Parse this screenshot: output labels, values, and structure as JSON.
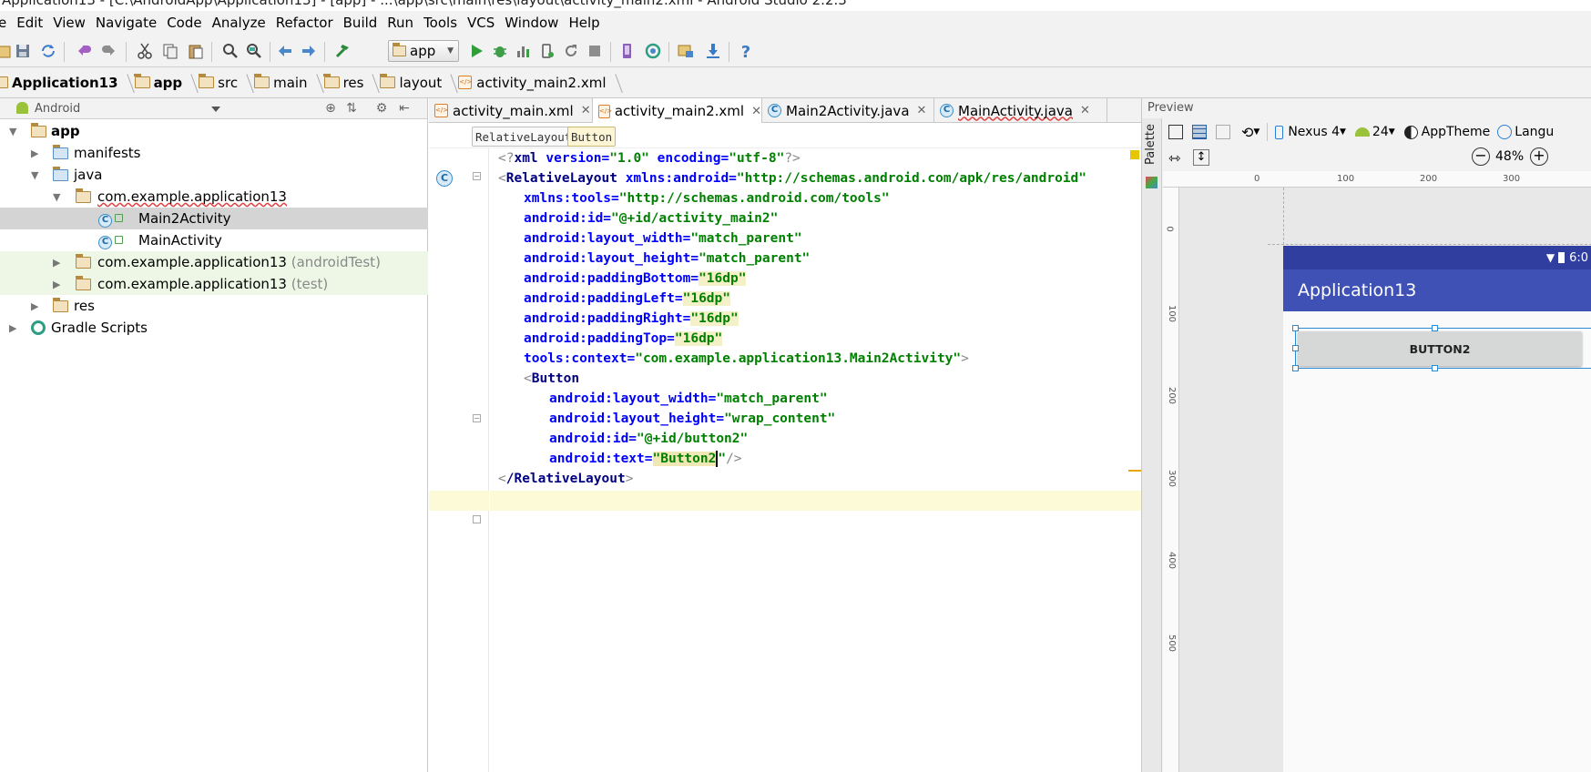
{
  "window": {
    "title": "Application13 - [C:\\AndroidApp\\Application13] - [app] - ...\\app\\src\\main\\res\\layout\\activity_main2.xml - Android Studio 2.2.3"
  },
  "menu": [
    "e",
    "Edit",
    "View",
    "Navigate",
    "Code",
    "Analyze",
    "Refactor",
    "Build",
    "Run",
    "Tools",
    "VCS",
    "Window",
    "Help"
  ],
  "toolbar": {
    "run_config": "app",
    "icons": [
      "save-icon",
      "sync-icon",
      "undo-icon",
      "redo-icon",
      "cut-icon",
      "copy-icon",
      "paste-icon",
      "find-icon",
      "replace-icon",
      "back-icon",
      "forward-icon",
      "make-icon",
      "run-icon",
      "debug-icon",
      "profile-icon",
      "attach-icon",
      "apply-changes-icon",
      "stop-icon",
      "avd-manager-icon",
      "sdk-manager-icon",
      "project-structure-icon",
      "download-icon",
      "help-icon"
    ]
  },
  "breadcrumbs": [
    "Application13",
    "app",
    "src",
    "main",
    "res",
    "layout",
    "activity_main2.xml"
  ],
  "project": {
    "view_mode": "Android",
    "tree": [
      {
        "label": "app",
        "bold": true
      },
      {
        "label": "manifests"
      },
      {
        "label": "java"
      },
      {
        "label": "com.example.application13"
      },
      {
        "label": "Main2Activity"
      },
      {
        "label": "MainActivity"
      },
      {
        "label": "com.example.application13",
        "suffix": "(androidTest)"
      },
      {
        "label": "com.example.application13",
        "suffix": "(test)"
      },
      {
        "label": "res"
      },
      {
        "label": "Gradle Scripts"
      }
    ]
  },
  "editor": {
    "tabs": [
      "activity_main.xml",
      "activity_main2.xml",
      "Main2Activity.java",
      "MainActivity.java"
    ],
    "active_tab": "activity_main2.xml",
    "xml_path": [
      "RelativeLayout",
      "Button"
    ],
    "code": {
      "decl_open": "<?",
      "decl_name": "xml",
      "decl_version_attr": " version=",
      "decl_version_val": "\"1.0\"",
      "decl_enc_attr": " encoding=",
      "decl_enc_val": "\"utf-8\"",
      "decl_close": "?>",
      "rl_tag": "RelativeLayout",
      "xmlns_android": "xmlns:android=",
      "xmlns_android_v": "\"http://schemas.android.com/apk/res/android\"",
      "xmlns_tools": "xmlns:tools=",
      "xmlns_tools_v": "\"http://schemas.android.com/tools\"",
      "a_id": "android:id=",
      "a_id_v": "\"@+id/activity_main2\"",
      "a_lw": "android:layout_width=",
      "a_lw_v": "\"match_parent\"",
      "a_lh": "android:layout_height=",
      "a_lh_v": "\"match_parent\"",
      "a_pb": "android:paddingBottom=",
      "a_pb_v": "\"16dp\"",
      "a_pl": "android:paddingLeft=",
      "a_pl_v": "\"16dp\"",
      "a_pr": "android:paddingRight=",
      "a_pr_v": "\"16dp\"",
      "a_pt": "android:paddingTop=",
      "a_pt_v": "\"16dp\"",
      "t_ctx": "tools:context=",
      "t_ctx_v": "\"com.example.application13.Main2Activity\"",
      "btn_tag": "Button",
      "b_lw": "android:layout_width=",
      "b_lw_v": "\"match_parent\"",
      "b_lh": "android:layout_height=",
      "b_lh_v": "\"wrap_content\"",
      "b_id": "android:id=",
      "b_id_v": "\"@+id/button2\"",
      "b_text": "android:text=",
      "b_text_v1": "\"Button2",
      "b_text_v2": "\"",
      "rl_close": "/RelativeLayout"
    }
  },
  "preview": {
    "title": "Preview",
    "palette_label": "Palette",
    "device": "Nexus 4",
    "api": "24",
    "theme": "AppTheme",
    "language": "Langu",
    "zoom": "48%",
    "ruler_top": [
      "0",
      "100",
      "200",
      "300"
    ],
    "ruler_left": [
      "0",
      "100",
      "200",
      "300",
      "400",
      "500"
    ],
    "phone": {
      "time": "6:0",
      "app_title": "Application13",
      "button_text": "BUTTON2"
    }
  }
}
